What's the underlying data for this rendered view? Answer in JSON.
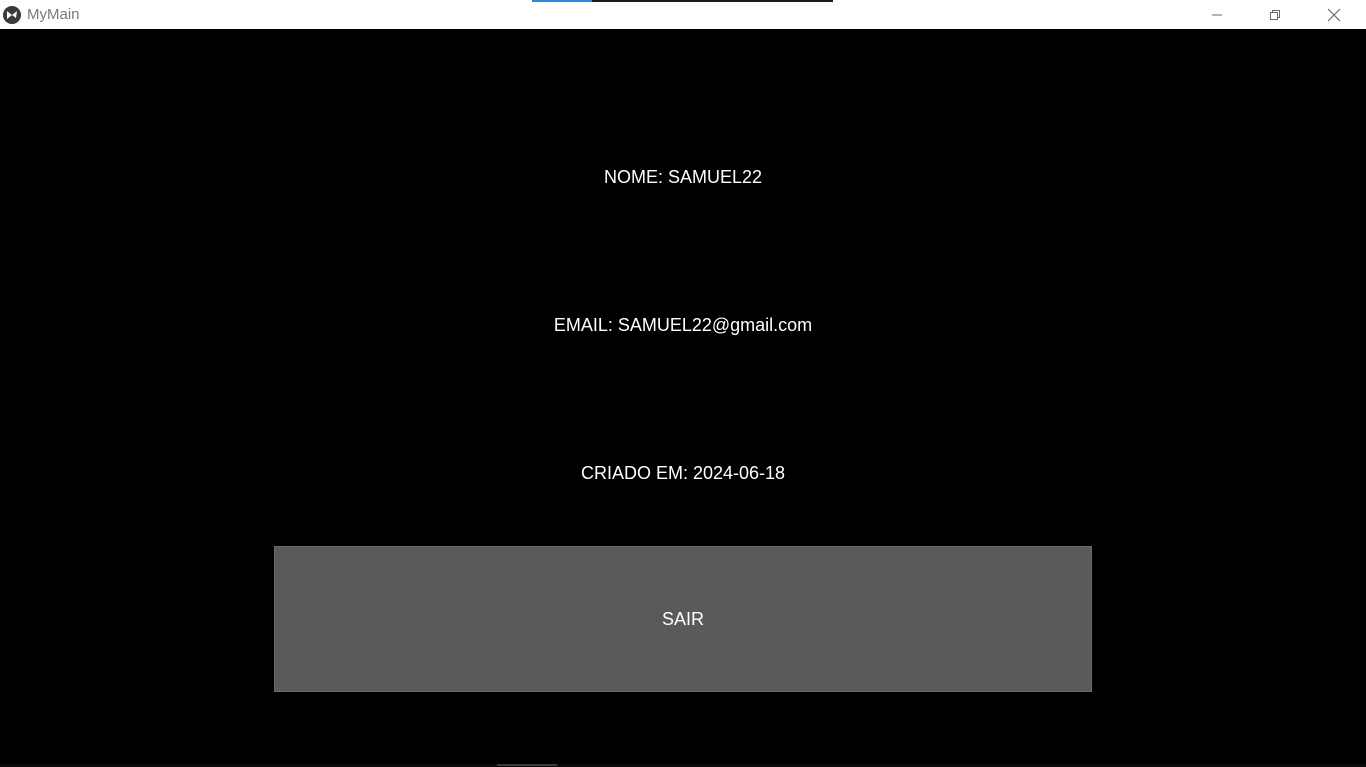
{
  "window": {
    "title": "MyMain",
    "icon": "kivy-logo-icon",
    "controls": {
      "minimize_icon": "minimize-icon",
      "maximize_icon": "restore-icon",
      "close_icon": "close-icon"
    },
    "progress": 0.2
  },
  "profile": {
    "name_text": "NOME: SAMUEL22",
    "email_text": "EMAIL: SAMUEL22@gmail.com",
    "created_text": "CRIADO EM: 2024-06-18"
  },
  "actions": {
    "exit_label": "SAIR"
  },
  "colors": {
    "background": "#000000",
    "button": "#5a5a5a",
    "text": "#ffffff",
    "accent": "#2f86d6"
  }
}
